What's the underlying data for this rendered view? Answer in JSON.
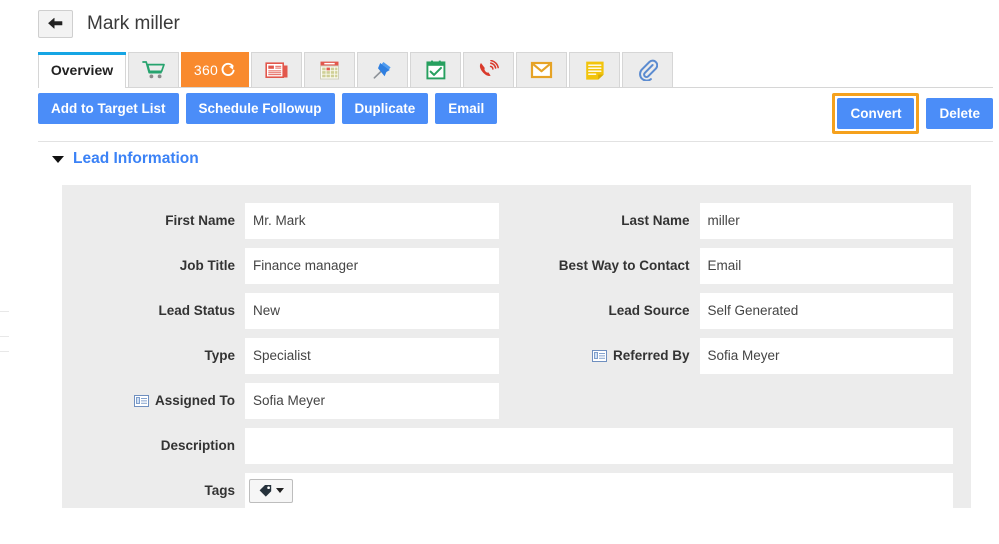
{
  "header": {
    "back_icon": "arrow-left-icon",
    "record_title": "Mark miller"
  },
  "tabs": [
    {
      "label": "Overview",
      "icon": "",
      "type": "text",
      "active": true
    },
    {
      "label": "",
      "icon": "shopping-cart-icon",
      "type": "icon",
      "active": false
    },
    {
      "label": "360",
      "icon": "refresh-circle-icon",
      "type": "360",
      "active": false
    },
    {
      "label": "",
      "icon": "newspaper-icon",
      "type": "icon",
      "active": false
    },
    {
      "label": "",
      "icon": "calendar-icon",
      "type": "icon",
      "active": false
    },
    {
      "label": "",
      "icon": "pin-icon",
      "type": "icon",
      "active": false
    },
    {
      "label": "",
      "icon": "calendar-check-icon",
      "type": "icon",
      "active": false
    },
    {
      "label": "",
      "icon": "phone-ring-icon",
      "type": "icon",
      "active": false
    },
    {
      "label": "",
      "icon": "envelope-icon",
      "type": "icon",
      "active": false
    },
    {
      "label": "",
      "icon": "note-icon",
      "type": "icon",
      "active": false
    },
    {
      "label": "",
      "icon": "paperclip-icon",
      "type": "icon",
      "active": false
    }
  ],
  "actions": {
    "add_to_target_list": "Add to Target List",
    "schedule_followup": "Schedule Followup",
    "duplicate": "Duplicate",
    "email": "Email",
    "convert": "Convert",
    "delete": "Delete"
  },
  "section": {
    "title": "Lead Information",
    "expanded": true,
    "chevron_icon": "chevron-down-icon"
  },
  "fields": {
    "first_name": {
      "label": "First Name",
      "value": "Mr. Mark",
      "icon": ""
    },
    "last_name": {
      "label": "Last Name",
      "value": "miller",
      "icon": ""
    },
    "job_title": {
      "label": "Job Title",
      "value": "Finance manager",
      "icon": ""
    },
    "best_way_to_contact": {
      "label": "Best Way to Contact",
      "value": "Email",
      "icon": ""
    },
    "lead_status": {
      "label": "Lead Status",
      "value": "New",
      "icon": ""
    },
    "lead_source": {
      "label": "Lead Source",
      "value": "Self Generated",
      "icon": ""
    },
    "type": {
      "label": "Type",
      "value": "Specialist",
      "icon": ""
    },
    "referred_by": {
      "label": "Referred By",
      "value": "Sofia Meyer",
      "icon": "vcard-icon"
    },
    "assigned_to": {
      "label": "Assigned To",
      "value": "Sofia Meyer",
      "icon": "vcard-icon"
    },
    "description": {
      "label": "Description",
      "value": "",
      "icon": ""
    },
    "tags": {
      "label": "Tags",
      "value": "",
      "icon": "tag-icon"
    }
  },
  "colors": {
    "primary_button": "#4b8df8",
    "highlight_ring": "#f5a11d",
    "tab_360": "#f98a2e",
    "active_tab_bar": "#16a5e4",
    "section_title": "#3b82f6",
    "panel_bg": "#ececec"
  }
}
